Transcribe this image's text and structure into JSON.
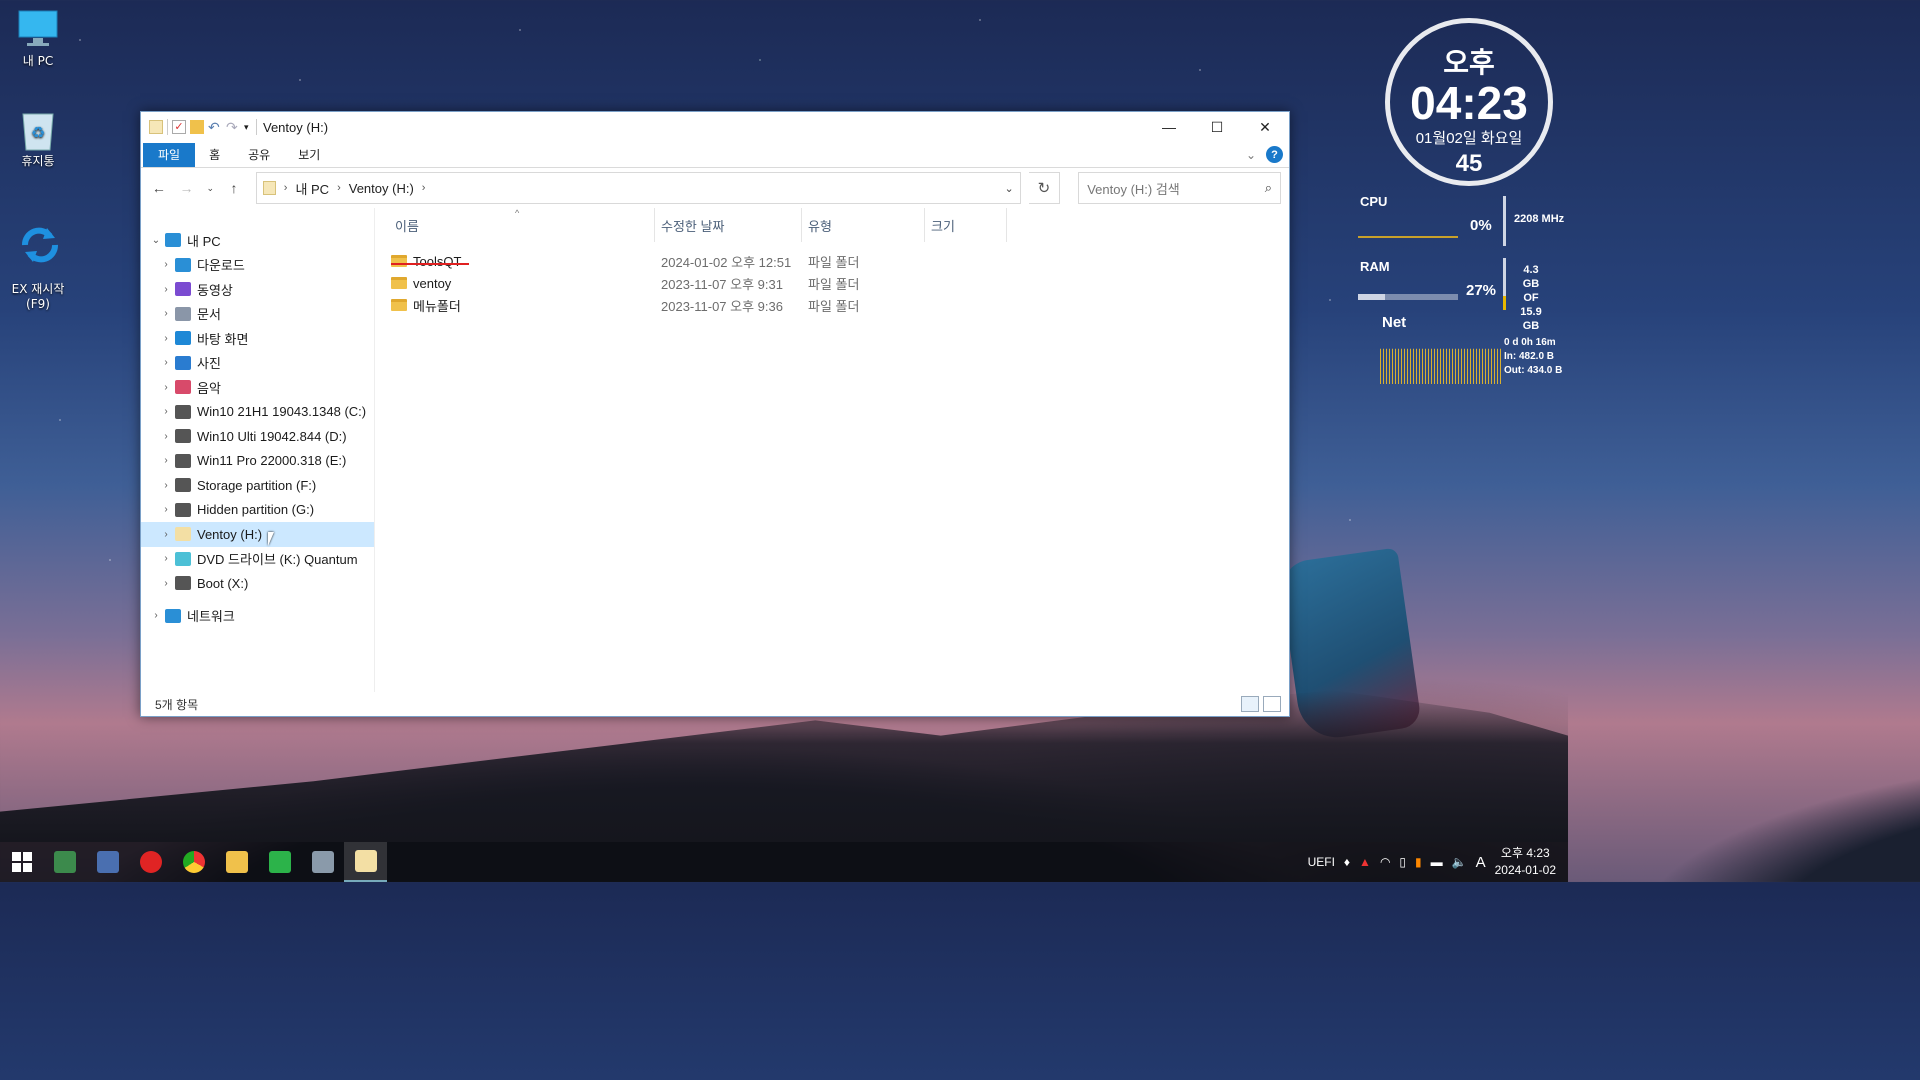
{
  "desktop": {
    "icons": [
      {
        "label": "내 PC"
      },
      {
        "label": "휴지통"
      },
      {
        "label": "EX 재시작\n(F9)"
      }
    ]
  },
  "widget": {
    "ampm": "오후",
    "time": "04:23",
    "date": "01월02일 화요일",
    "seconds": "45",
    "cpu": {
      "label": "CPU",
      "percent": "0%",
      "freq": "2208 MHz"
    },
    "ram": {
      "label": "RAM",
      "percent": "27%",
      "used": "4.3 GB",
      "of": "OF",
      "total": "15.9 GB"
    },
    "net": {
      "label": "Net",
      "uptime": "0 d 0h 16m",
      "in": "In: 482.0 B",
      "out": "Out: 434.0 B"
    }
  },
  "window": {
    "title": "Ventoy (H:)",
    "ribbon": {
      "tabs": [
        "파일",
        "홈",
        "공유",
        "보기"
      ]
    },
    "address": {
      "crumbs": [
        "내 PC",
        "Ventoy (H:)"
      ],
      "search_placeholder": "Ventoy (H:) 검색"
    },
    "tree": [
      {
        "label": "내 PC",
        "level": 0,
        "color": "#2a8fd6"
      },
      {
        "label": "다운로드",
        "level": 1,
        "color": "#2a8fd6"
      },
      {
        "label": "동영상",
        "level": 1,
        "color": "#7b4bd1"
      },
      {
        "label": "문서",
        "level": 1,
        "color": "#8a96a8"
      },
      {
        "label": "바탕 화면",
        "level": 1,
        "color": "#1e88d6"
      },
      {
        "label": "사진",
        "level": 1,
        "color": "#2a7cd0"
      },
      {
        "label": "음악",
        "level": 1,
        "color": "#d84a6a"
      },
      {
        "label": "Win10 21H1 19043.1348 (C:)",
        "level": 1,
        "color": "#555"
      },
      {
        "label": "Win10 Ulti 19042.844 (D:)",
        "level": 1,
        "color": "#555"
      },
      {
        "label": "Win11 Pro 22000.318 (E:)",
        "level": 1,
        "color": "#555"
      },
      {
        "label": "Storage partition (F:)",
        "level": 1,
        "color": "#555"
      },
      {
        "label": "Hidden partition (G:)",
        "level": 1,
        "color": "#555"
      },
      {
        "label": "Ventoy (H:)",
        "level": 1,
        "color": "#f3dfa4",
        "selected": true
      },
      {
        "label": "DVD 드라이브 (K:) Quantum",
        "level": 1,
        "color": "#4cc0d6"
      },
      {
        "label": "Boot (X:)",
        "level": 1,
        "color": "#555"
      },
      {
        "label": "네트워크",
        "level": 0,
        "color": "#2a8fd6"
      }
    ],
    "columns": [
      "이름",
      "수정한 날짜",
      "유형",
      "크기"
    ],
    "files": [
      {
        "name": "ToolsQT",
        "date": "2024-01-02 오후 12:51",
        "type": "파일 폴더",
        "size": ""
      },
      {
        "name": "ventoy",
        "date": "2023-11-07 오후 9:31",
        "type": "파일 폴더",
        "size": ""
      },
      {
        "name": "메뉴폴더",
        "date": "2023-11-07 오후 9:36",
        "type": "파일 폴더",
        "size": ""
      }
    ],
    "status": "5개 항목"
  },
  "taskbar": {
    "tray_label": "UEFI",
    "time": "오후 4:23",
    "date": "2024-01-02",
    "ime": "A"
  }
}
